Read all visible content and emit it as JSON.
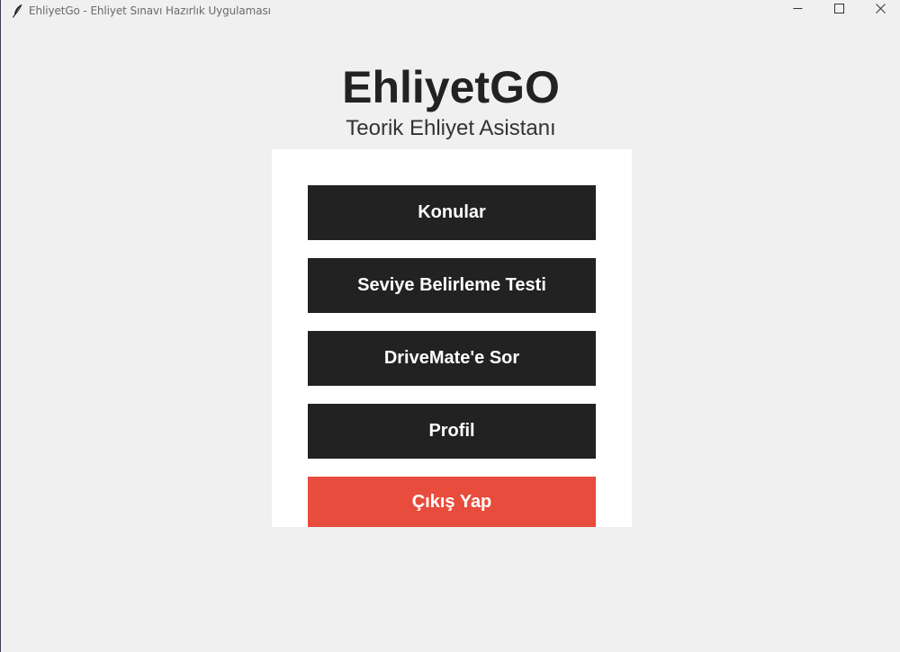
{
  "window": {
    "title": "EhliyetGo - Ehliyet Sınavı Hazırlık Uygulaması",
    "icon": "feather-icon",
    "controls": [
      "minimize-icon",
      "maximize-icon",
      "close-icon"
    ]
  },
  "header": {
    "title": "EhliyetGO",
    "subtitle": "Teorik Ehliyet Asistanı"
  },
  "menu": {
    "items": [
      {
        "label": "Konular"
      },
      {
        "label": "Seviye Belirleme Testi"
      },
      {
        "label": "DriveMate'e Sor"
      },
      {
        "label": "Profil"
      },
      {
        "label": "Çıkış Yap"
      }
    ]
  },
  "colors": {
    "background": "#f0f0f0",
    "panel": "#ffffff",
    "button": "#222222",
    "button_text": "#ffffff",
    "danger": "#e74c3c"
  }
}
